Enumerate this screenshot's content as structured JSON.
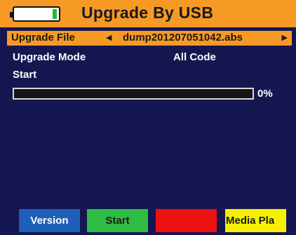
{
  "header": {
    "title": "Upgrade By USB",
    "battery_icon": "battery-icon"
  },
  "file_selector": {
    "label": "Upgrade File",
    "left_arrow": "◀",
    "value": "dump201207051042.abs",
    "right_arrow": "▶"
  },
  "upgrade_mode": {
    "label": "Upgrade Mode",
    "value": "All Code"
  },
  "status_text": "Start",
  "progress": {
    "fraction": 0,
    "label": "0%"
  },
  "function_keys": {
    "blue": "Version",
    "green": "Start",
    "red": "",
    "yellow": "Media Pla"
  },
  "colors": {
    "background": "#161650",
    "header": "#f79a25",
    "blue_key": "#1e5fb8",
    "green_key": "#2ebd45",
    "red_key": "#ee1111",
    "yellow_key": "#f4f000"
  }
}
